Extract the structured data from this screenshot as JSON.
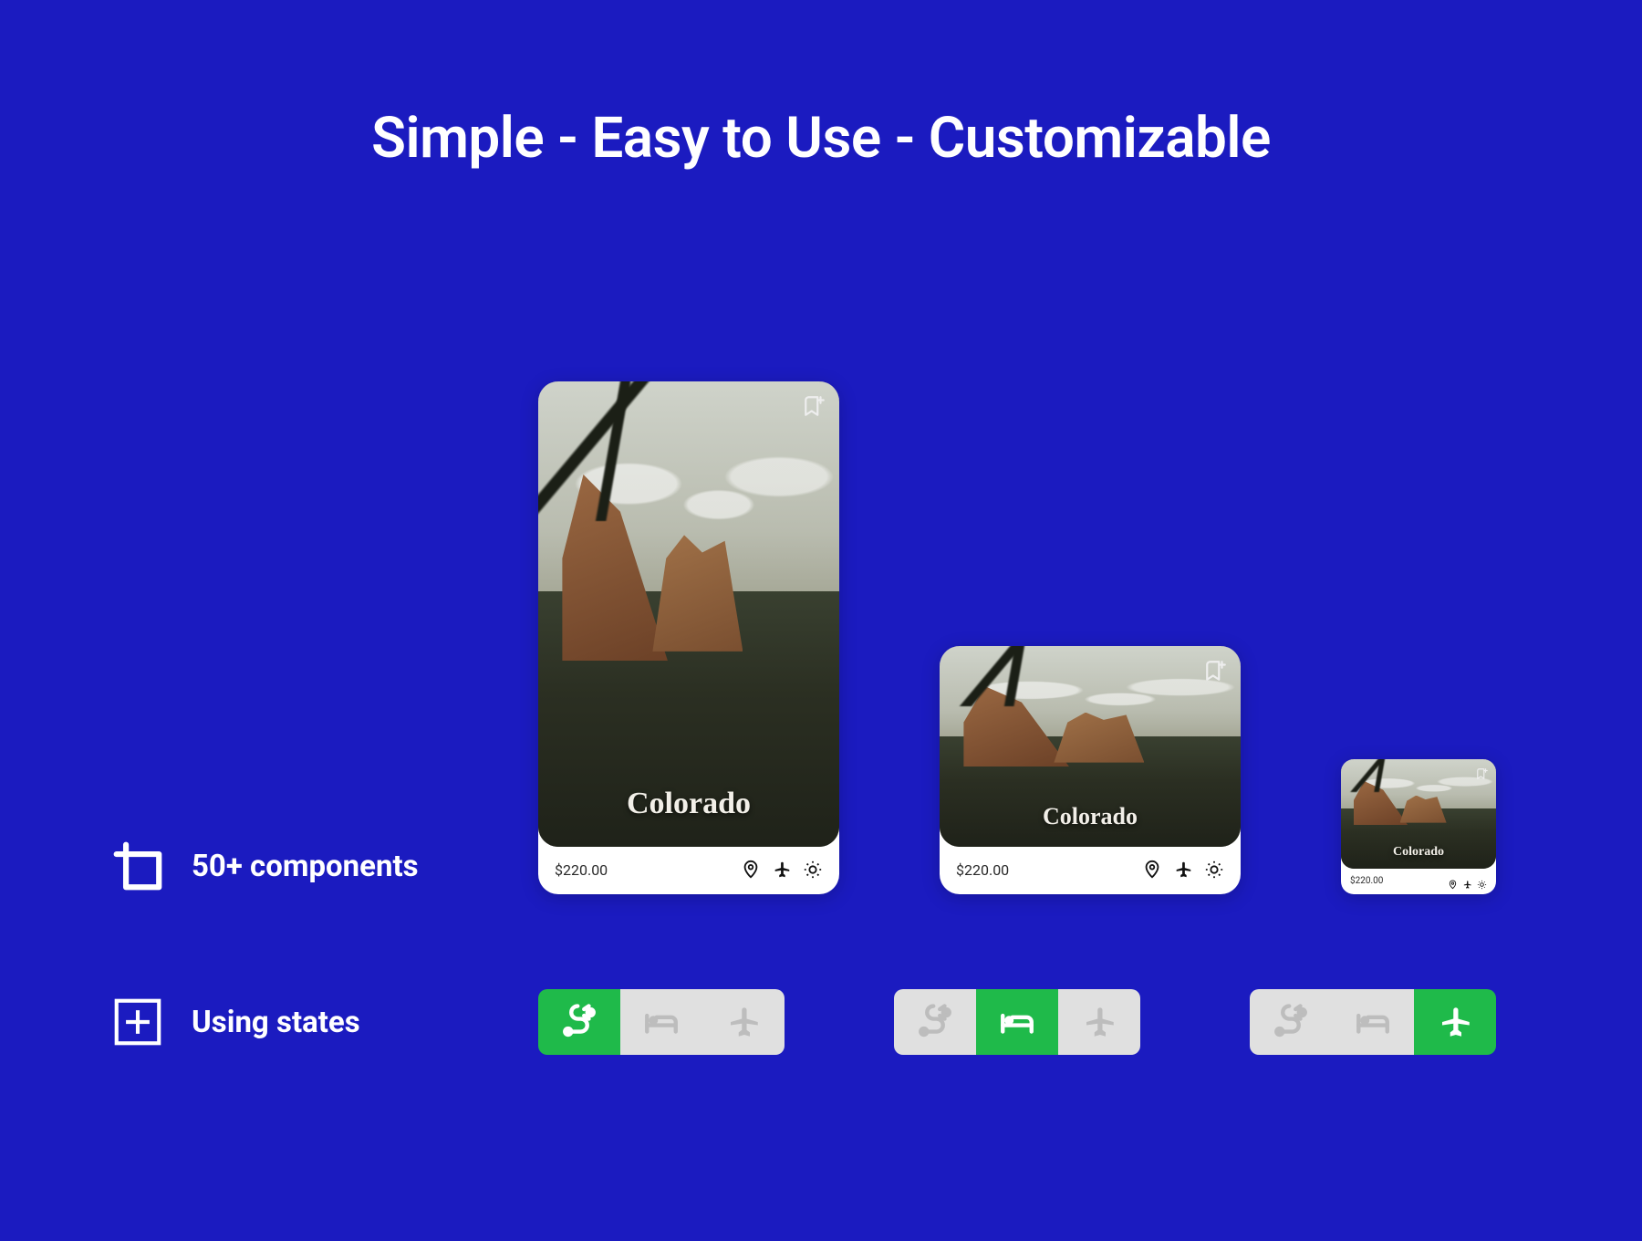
{
  "headline": "Simple - Easy to Use - Customizable",
  "labels": {
    "components": "50+ components",
    "states": "Using states"
  },
  "cards": [
    {
      "title": "Colorado",
      "price": "$220.00",
      "icon": "bookmark-add-icon"
    },
    {
      "title": "Colorado",
      "price": "$220.00",
      "icon": "bookmark-add-icon"
    },
    {
      "title": "Colorado",
      "price": "$220.00",
      "icon": "bookmark-add-icon"
    }
  ],
  "cardFooterIcons": [
    "map-pin-icon",
    "airplane-icon",
    "sun-icon"
  ],
  "stateGroups": [
    {
      "active": 0,
      "tabs": [
        "route-icon",
        "bed-icon",
        "airplane-icon"
      ]
    },
    {
      "active": 1,
      "tabs": [
        "route-icon",
        "bed-icon",
        "airplane-icon"
      ]
    },
    {
      "active": 2,
      "tabs": [
        "route-icon",
        "bed-icon",
        "airplane-icon"
      ]
    }
  ],
  "colors": {
    "accent": "#1fba4a",
    "bg": "#1b1bc0"
  }
}
